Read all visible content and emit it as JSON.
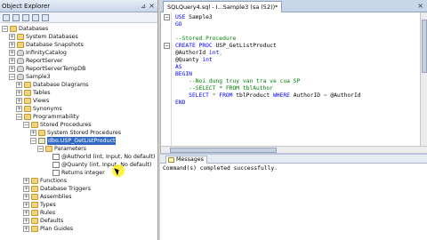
{
  "object_explorer": {
    "title": "Object Explorer",
    "tree": [
      {
        "label": "Databases",
        "icon": "folder",
        "expander": "−",
        "indent": 0
      },
      {
        "label": "System Databases",
        "icon": "folder",
        "expander": "+",
        "indent": 1
      },
      {
        "label": "Database Snapshots",
        "icon": "folder",
        "expander": "+",
        "indent": 1
      },
      {
        "label": "InfinityCatalog",
        "icon": "database",
        "expander": "+",
        "indent": 1
      },
      {
        "label": "ReportServer",
        "icon": "database",
        "expander": "+",
        "indent": 1
      },
      {
        "label": "ReportServerTempDB",
        "icon": "database",
        "expander": "+",
        "indent": 1
      },
      {
        "label": "Sample3",
        "icon": "database",
        "expander": "−",
        "indent": 1
      },
      {
        "label": "Database Diagrams",
        "icon": "folder",
        "expander": "+",
        "indent": 2
      },
      {
        "label": "Tables",
        "icon": "folder",
        "expander": "+",
        "indent": 2
      },
      {
        "label": "Views",
        "icon": "folder",
        "expander": "+",
        "indent": 2
      },
      {
        "label": "Synonyms",
        "icon": "folder",
        "expander": "+",
        "indent": 2
      },
      {
        "label": "Programmability",
        "icon": "folder",
        "expander": "−",
        "indent": 2
      },
      {
        "label": "Stored Procedures",
        "icon": "folder",
        "expander": "−",
        "indent": 3
      },
      {
        "label": "System Stored Procedures",
        "icon": "folder",
        "expander": "+",
        "indent": 4
      },
      {
        "label": "dbo.USP_GetListProduct",
        "icon": "procedure",
        "expander": "−",
        "indent": 4,
        "selected": true
      },
      {
        "label": "Parameters",
        "icon": "folder",
        "expander": "−",
        "indent": 5
      },
      {
        "label": "@AuthorId (int, Input, No default)",
        "icon": "parameter",
        "expander": "",
        "indent": 6
      },
      {
        "label": "@Quanty (int, Input, No default)",
        "icon": "parameter",
        "expander": "",
        "indent": 6
      },
      {
        "label": "Returns integer",
        "icon": "parameter",
        "expander": "",
        "indent": 6
      },
      {
        "label": "Functions",
        "icon": "folder",
        "expander": "+",
        "indent": 3
      },
      {
        "label": "Database Triggers",
        "icon": "folder",
        "expander": "+",
        "indent": 3
      },
      {
        "label": "Assemblies",
        "icon": "folder",
        "expander": "+",
        "indent": 3
      },
      {
        "label": "Types",
        "icon": "folder",
        "expander": "+",
        "indent": 3
      },
      {
        "label": "Rules",
        "icon": "folder",
        "expander": "+",
        "indent": 3
      },
      {
        "label": "Defaults",
        "icon": "folder",
        "expander": "+",
        "indent": 3
      },
      {
        "label": "Plan Guides",
        "icon": "folder",
        "expander": "+",
        "indent": 3
      }
    ]
  },
  "editor": {
    "tab_label": "SQLQuery4.sql - I...Sample3 (sa (52))*",
    "lines": [
      [
        {
          "t": "USE ",
          "c": "kw"
        },
        {
          "t": "Sample3",
          "c": "pl"
        }
      ],
      [
        {
          "t": "GO",
          "c": "kw"
        }
      ],
      [
        {
          "t": "",
          "c": "pl"
        }
      ],
      [
        {
          "t": "--Stored Procedure",
          "c": "cm"
        }
      ],
      [
        {
          "t": "CREATE PROC ",
          "c": "kw"
        },
        {
          "t": "USP_GetListProduct",
          "c": "pl"
        }
      ],
      [
        {
          "t": "@AuthorId ",
          "c": "pl"
        },
        {
          "t": "int",
          "c": "kw"
        },
        {
          "t": ",",
          "c": "gr"
        }
      ],
      [
        {
          "t": "@Quanty ",
          "c": "pl"
        },
        {
          "t": "int",
          "c": "kw"
        }
      ],
      [
        {
          "t": "AS",
          "c": "kw"
        }
      ],
      [
        {
          "t": "BEGIN",
          "c": "kw"
        }
      ],
      [
        {
          "t": "    --Noi dung truy van tra ve cua SP",
          "c": "cm"
        }
      ],
      [
        {
          "t": "    --SELECT * FROM tblAuthor",
          "c": "cm"
        }
      ],
      [
        {
          "t": "    SELECT ",
          "c": "kw"
        },
        {
          "t": "* ",
          "c": "gr"
        },
        {
          "t": "FROM ",
          "c": "kw"
        },
        {
          "t": "tblProduct ",
          "c": "pl"
        },
        {
          "t": "WHERE ",
          "c": "kw"
        },
        {
          "t": "AuthorID ",
          "c": "pl"
        },
        {
          "t": "= ",
          "c": "gr"
        },
        {
          "t": "@AuthorId",
          "c": "pl"
        }
      ],
      [
        {
          "t": "END",
          "c": "kw"
        }
      ]
    ]
  },
  "results": {
    "tab_label": "Messages",
    "message": "Command(s) completed successfully."
  },
  "colors": {
    "keyword": "#0000ff",
    "comment": "#008000",
    "operator": "#808080",
    "selection": "#316ac5"
  }
}
